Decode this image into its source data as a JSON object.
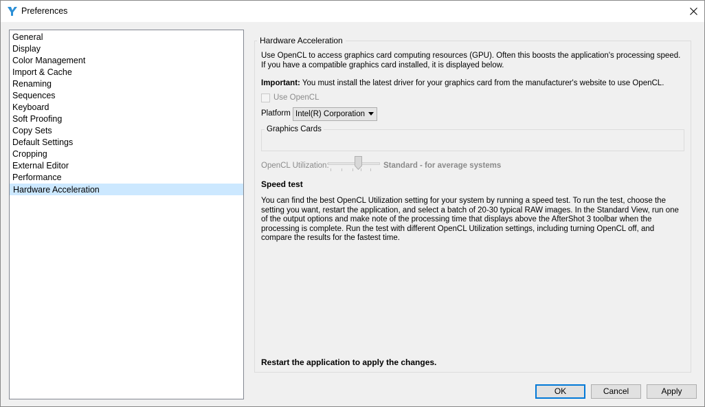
{
  "window": {
    "title": "Preferences",
    "app_icon": "aftershot-icon",
    "close_icon": "close-icon"
  },
  "sidebar": {
    "items": [
      {
        "label": "General"
      },
      {
        "label": "Display"
      },
      {
        "label": "Color Management"
      },
      {
        "label": "Import & Cache"
      },
      {
        "label": "Renaming"
      },
      {
        "label": "Sequences"
      },
      {
        "label": "Keyboard"
      },
      {
        "label": "Soft Proofing"
      },
      {
        "label": "Copy Sets"
      },
      {
        "label": "Default Settings"
      },
      {
        "label": "Cropping"
      },
      {
        "label": "External Editor"
      },
      {
        "label": "Performance"
      },
      {
        "label": "Hardware Acceleration",
        "selected": true
      }
    ]
  },
  "panel": {
    "group_title": "Hardware Acceleration",
    "description": "Use OpenCL to access graphics card computing resources (GPU). Often this boosts the application's processing speed. If you have a compatible graphics card installed, it is displayed below.",
    "important_label": "Important:",
    "important_text": " You must install the latest driver for your graphics card from the manufacturer's website to use OpenCL.",
    "use_opencl_label": "Use OpenCL",
    "use_opencl_checked": false,
    "platform_label": "Platform",
    "platform_value": "Intel(R) Corporation",
    "graphics_cards_title": "Graphics Cards",
    "utilization_label": "OpenCL Utilization:",
    "utilization_value": "Standard - for average systems",
    "utilization_level": 0.6,
    "speed_test_heading": "Speed test",
    "speed_test_text": "You can find the best OpenCL Utilization setting for your system by running a speed test. To run the test, choose the setting you want, restart the application, and select a batch of 20-30 typical RAW images. In the Standard View, run one of the output options and make note of the processing time that displays above the AfterShot 3 toolbar when the processing is complete. Run the test with different OpenCL Utilization settings, including turning OpenCL off, and compare the results for the fastest time.",
    "restart_note": "Restart the application to apply the changes."
  },
  "buttons": {
    "ok": "OK",
    "cancel": "Cancel",
    "apply": "Apply"
  },
  "colors": {
    "selection": "#cce8ff",
    "default_button_border": "#0078d7",
    "disabled_text": "#8a8a8a"
  }
}
